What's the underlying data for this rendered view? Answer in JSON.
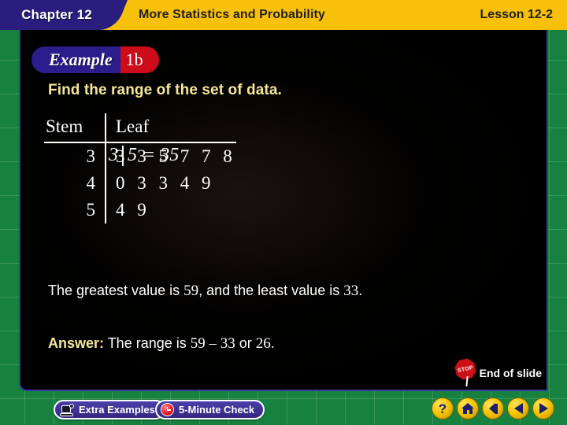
{
  "header": {
    "chapter": "Chapter 12",
    "title": "More Statistics and Probability",
    "lesson": "Lesson 12-2"
  },
  "example_badge": {
    "label": "Example",
    "number": "1b"
  },
  "content": {
    "prompt": "Find the range of the set of data.",
    "stem_leaf": {
      "stem_header": "Stem",
      "leaf_header": "Leaf",
      "rows": [
        {
          "stem": "3",
          "leaf": "3 3 5 7 7 8"
        },
        {
          "stem": "4",
          "leaf": "0 3 3 4 9"
        },
        {
          "stem": "5",
          "leaf": "4 9"
        }
      ],
      "key_stem": "3",
      "key_leaf": "5",
      "key_equals": "= 35"
    },
    "statement_1_a": "The greatest value is ",
    "statement_1_n1": "59",
    "statement_1_b": ", and the least value is ",
    "statement_1_n2": "33",
    "statement_1_c": ".",
    "answer_label": "Answer:",
    "answer_a": " The range is ",
    "answer_n1": "59 – 33",
    "answer_b": " or ",
    "answer_n2": "26",
    "answer_c": ".",
    "end_of_slide": "End of slide",
    "stop_sign_text": "STOP"
  },
  "footer": {
    "extra_examples": "Extra Examples",
    "five_minute_check": "5-Minute Check",
    "nav": {
      "help": "?",
      "home": "home-icon",
      "prev_section": "rewind-icon",
      "back": "back-arrow-icon",
      "next": "next-arrow-icon"
    }
  },
  "colors": {
    "header_bg": "#f7c00a",
    "chapter_tab": "#2b1d7e",
    "panel_bg": "#000000",
    "frame_green": "#17813f",
    "accent_yellow_text": "#f5e89a",
    "badge_blue": "#2b1d8c",
    "badge_red": "#cc0c18",
    "nav_button": "#f5c400"
  }
}
